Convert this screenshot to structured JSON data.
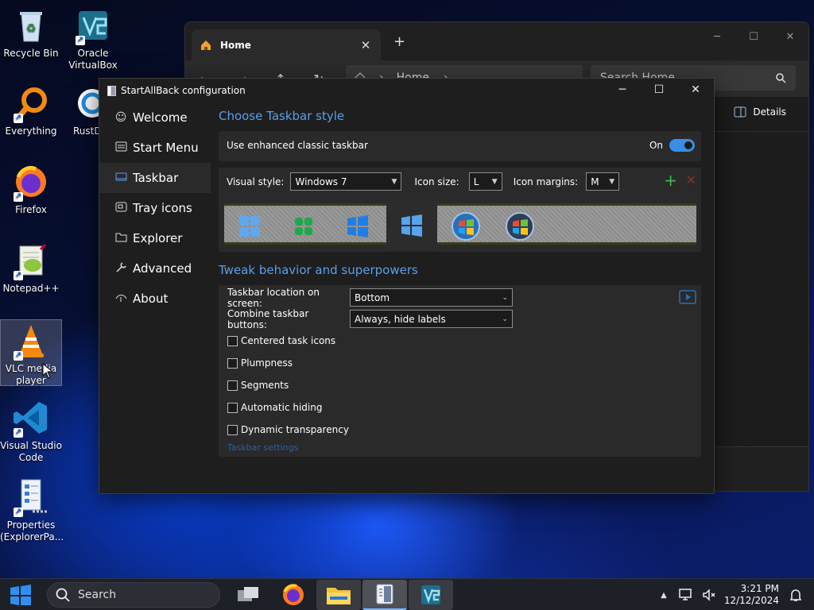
{
  "desktop": {
    "icons": [
      {
        "label": "Recycle Bin",
        "icon": "recycle-bin-icon"
      },
      {
        "label": "Oracle VirtualBox",
        "icon": "virtualbox-icon"
      },
      {
        "label": "Everything",
        "icon": "everything-search-icon"
      },
      {
        "label": "RustD",
        "icon": "rustdesk-icon"
      },
      {
        "label": "Firefox",
        "icon": "firefox-icon"
      },
      {
        "label": "Notepad++",
        "icon": "notepad-plus-plus-icon"
      },
      {
        "label": "VLC media player",
        "icon": "vlc-icon"
      },
      {
        "label": "Visual Studio Code",
        "icon": "vscode-icon"
      },
      {
        "label": "Properties (ExplorerPa...",
        "icon": "properties-icon"
      }
    ]
  },
  "explorer": {
    "tab_label": "Home",
    "address_label": "Home",
    "search_placeholder": "Search Home",
    "details_label": "Details"
  },
  "sab": {
    "title": "StartAllBack configuration",
    "sidebar": [
      {
        "label": "Welcome",
        "icon": "smile-icon"
      },
      {
        "label": "Start Menu",
        "icon": "start-menu-icon"
      },
      {
        "label": "Taskbar",
        "icon": "taskbar-icon"
      },
      {
        "label": "Tray icons",
        "icon": "tray-icon"
      },
      {
        "label": "Explorer",
        "icon": "folder-icon"
      },
      {
        "label": "Advanced",
        "icon": "wrench-icon"
      },
      {
        "label": "About",
        "icon": "about-icon"
      }
    ],
    "active_section": "Taskbar",
    "section1_title": "Choose Taskbar style",
    "enhanced_label": "Use enhanced classic taskbar",
    "enhanced_state": "On",
    "visual_style_label": "Visual style:",
    "visual_style_value": "Windows 7",
    "icon_size_label": "Icon size:",
    "icon_size_value": "L",
    "icon_margins_label": "Icon margins:",
    "icon_margins_value": "M",
    "section2_title": "Tweak behavior and superpowers",
    "location_label": "Taskbar location on screen:",
    "location_value": "Bottom",
    "combine_label": "Combine taskbar buttons:",
    "combine_value": "Always, hide labels",
    "checkboxes": [
      {
        "label": "Centered task icons",
        "checked": false
      },
      {
        "label": "Plumpness",
        "checked": false
      },
      {
        "label": "Segments",
        "checked": false
      },
      {
        "label": "Automatic hiding",
        "checked": false
      },
      {
        "label": "Dynamic transparency",
        "checked": false
      }
    ],
    "settings_link": "Taskbar settings",
    "accent_color": "#5b9fe8"
  },
  "taskbar": {
    "search_label": "Search",
    "time": "3:21 PM",
    "date": "12/12/2024"
  }
}
